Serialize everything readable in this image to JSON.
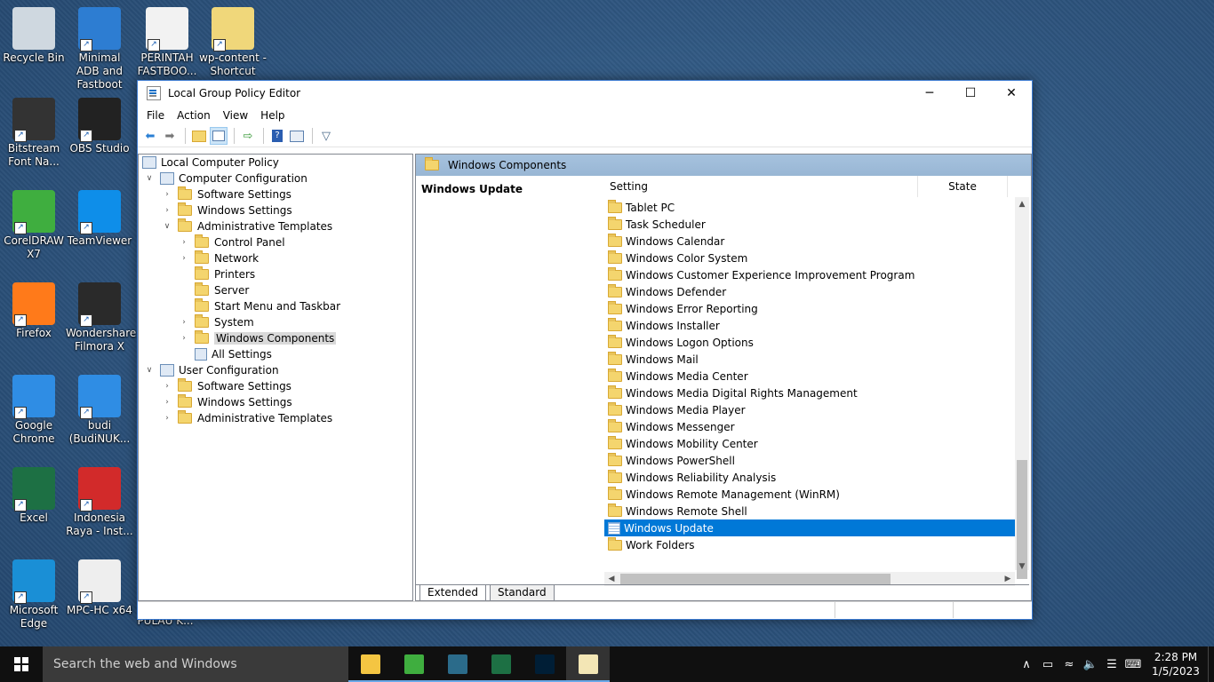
{
  "desktop": {
    "icons": [
      {
        "label": "Recycle Bin",
        "color": "#cfd8e0"
      },
      {
        "label": "Minimal ADB and Fastboot",
        "color": "#2d7dd2"
      },
      {
        "label": "PERINTAH FASTBOO...",
        "color": "#f2f2f2"
      },
      {
        "label": "wp-content - Shortcut",
        "color": "#f0d77a"
      },
      {
        "label": "Bitstream Font Na...",
        "color": "#333333"
      },
      {
        "label": "OBS Studio",
        "color": "#222222"
      },
      {
        "label": "CorelDRAW X7",
        "color": "#3fae3f"
      },
      {
        "label": "TeamViewer",
        "color": "#0e8ee9"
      },
      {
        "label": "Firefox",
        "color": "#ff7a1a"
      },
      {
        "label": "Wondershare Filmora X",
        "color": "#2a2a2a"
      },
      {
        "label": "Google Chrome",
        "color": "#2f8de4"
      },
      {
        "label": "budi (BudiNUK...",
        "color": "#2f8de4"
      },
      {
        "label": "Excel",
        "color": "#1d7044"
      },
      {
        "label": "Indonesia Raya - Inst...",
        "color": "#d22a2a"
      },
      {
        "label": "Microsoft Edge",
        "color": "#1a8fd6"
      },
      {
        "label": "MPC-HC x64",
        "color": "#eeeeee"
      },
      {
        "label": "PULAU K...",
        "color": "#f0d77a"
      }
    ]
  },
  "window": {
    "title": "Local Group Policy Editor",
    "controls": {
      "minimize": "─",
      "maximize": "☐",
      "close": "✕"
    },
    "menu": [
      "File",
      "Action",
      "View",
      "Help"
    ],
    "tree": {
      "root": "Local Computer Policy",
      "computer_config": "Computer Configuration",
      "cc_software": "Software Settings",
      "cc_windows": "Windows Settings",
      "cc_admin": "Administrative Templates",
      "at_control_panel": "Control Panel",
      "at_network": "Network",
      "at_printers": "Printers",
      "at_server": "Server",
      "at_start_menu": "Start Menu and Taskbar",
      "at_system": "System",
      "at_windows_components": "Windows Components",
      "at_all_settings": "All Settings",
      "user_config": "User Configuration",
      "uc_software": "Software Settings",
      "uc_windows": "Windows Settings",
      "uc_admin": "Administrative Templates"
    },
    "right": {
      "header": "Windows Components",
      "selected_title": "Windows Update",
      "col_setting": "Setting",
      "col_state": "State",
      "items": [
        "Tablet PC",
        "Task Scheduler",
        "Windows Calendar",
        "Windows Color System",
        "Windows Customer Experience Improvement Program",
        "Windows Defender",
        "Windows Error Reporting",
        "Windows Installer",
        "Windows Logon Options",
        "Windows Mail",
        "Windows Media Center",
        "Windows Media Digital Rights Management",
        "Windows Media Player",
        "Windows Messenger",
        "Windows Mobility Center",
        "Windows PowerShell",
        "Windows Reliability Analysis",
        "Windows Remote Management (WinRM)",
        "Windows Remote Shell",
        "Windows Update",
        "Work Folders"
      ],
      "selected_item": "Windows Update",
      "tabs": [
        "Extended",
        "Standard"
      ]
    }
  },
  "taskbar": {
    "search_placeholder": "Search the web and Windows",
    "apps": [
      {
        "name": "file-explorer",
        "color": "#f4c542"
      },
      {
        "name": "coreldraw",
        "color": "#3fae3f"
      },
      {
        "name": "filmora",
        "color": "#2b6b8a"
      },
      {
        "name": "excel",
        "color": "#1d7044"
      },
      {
        "name": "photoshop",
        "color": "#001e36"
      },
      {
        "name": "notepad",
        "color": "#f3e6b5"
      }
    ],
    "time": "2:28 PM",
    "date": "1/5/2023"
  }
}
